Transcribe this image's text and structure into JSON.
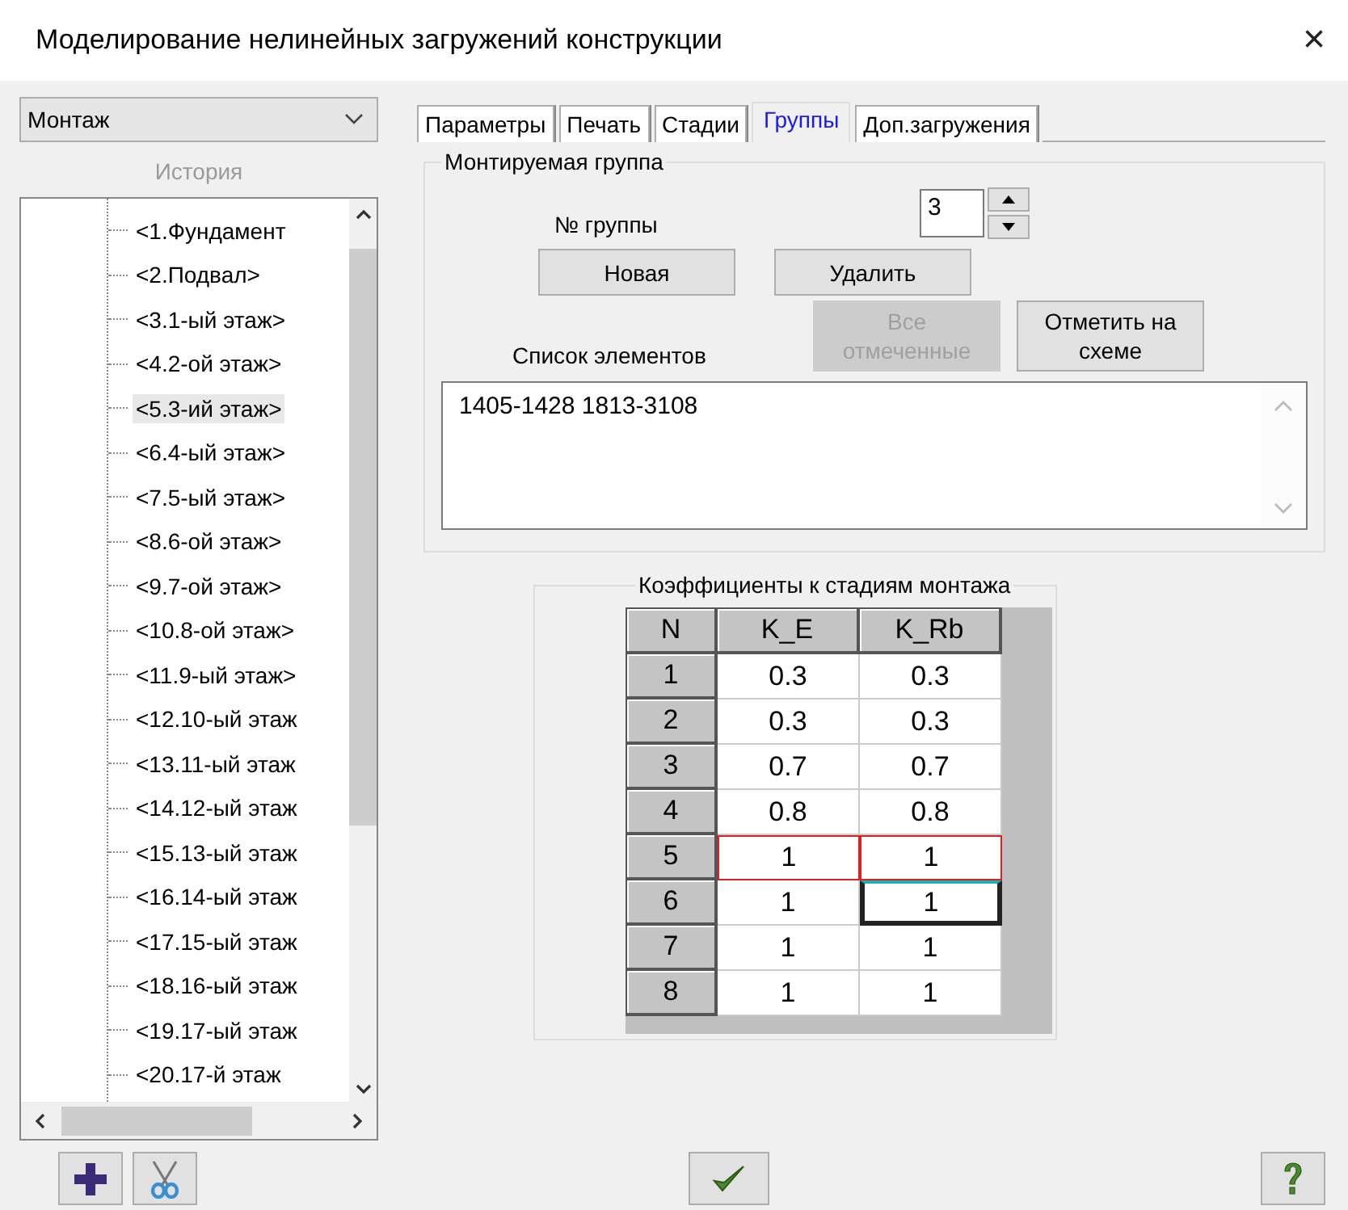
{
  "window": {
    "title": "Моделирование нелинейных загружений конструкции",
    "close": "×"
  },
  "sidebar": {
    "mode": "Монтаж",
    "history_label": "История",
    "history_disabled": true,
    "items": [
      {
        "label": "<1.Фундамент",
        "selected": false
      },
      {
        "label": "<2.Подвал>",
        "selected": false
      },
      {
        "label": "<3.1-ый этаж>",
        "selected": false
      },
      {
        "label": "<4.2-ой этаж>",
        "selected": false
      },
      {
        "label": "<5.3-ий этаж>",
        "selected": true
      },
      {
        "label": "<6.4-ый этаж>",
        "selected": false
      },
      {
        "label": "<7.5-ый этаж>",
        "selected": false
      },
      {
        "label": "<8.6-ой этаж>",
        "selected": false
      },
      {
        "label": "<9.7-ой этаж>",
        "selected": false
      },
      {
        "label": "<10.8-ой этаж>",
        "selected": false
      },
      {
        "label": "<11.9-ый этаж>",
        "selected": false
      },
      {
        "label": "<12.10-ый этаж",
        "selected": false
      },
      {
        "label": "<13.11-ый этаж",
        "selected": false
      },
      {
        "label": "<14.12-ый этаж",
        "selected": false
      },
      {
        "label": "<15.13-ый этаж",
        "selected": false
      },
      {
        "label": "<16.14-ый этаж",
        "selected": false
      },
      {
        "label": "<17.15-ый этаж",
        "selected": false
      },
      {
        "label": "<18.16-ый этаж",
        "selected": false
      },
      {
        "label": "<19.17-ый этаж",
        "selected": false
      },
      {
        "label": "<20.17-й этаж",
        "selected": false
      }
    ]
  },
  "tabs": [
    {
      "label": "Параметры",
      "selected": false
    },
    {
      "label": "Печать",
      "selected": false
    },
    {
      "label": "Стадии",
      "selected": false
    },
    {
      "label": "Группы",
      "selected": true
    },
    {
      "label": "Доп.загружения",
      "selected": false
    }
  ],
  "group": {
    "title": "Монтируемая группа",
    "number_label": "№ группы",
    "number": "3",
    "buttons": [
      {
        "label": "Новая",
        "disabled": false
      },
      {
        "label": "Удалить",
        "disabled": false
      }
    ],
    "list_label": "Список элементов",
    "side_buttons": [
      {
        "label": "Все отмеченные",
        "disabled": true
      },
      {
        "label": "Отметить на схеме",
        "disabled": false
      }
    ],
    "elements": "1405-1428 1813-3108"
  },
  "coefficients": {
    "title": "Коэффициенты к стадиям монтажа",
    "columns": [
      "N",
      "K_E",
      "K_Rb"
    ],
    "rows": [
      {
        "highlighted": false,
        "cells": [
          {
            "text": "1",
            "focused": false
          },
          {
            "text": "0.3",
            "focused": false
          },
          {
            "text": "0.3",
            "focused": false
          }
        ]
      },
      {
        "highlighted": false,
        "cells": [
          {
            "text": "2",
            "focused": false
          },
          {
            "text": "0.3",
            "focused": false
          },
          {
            "text": "0.3",
            "focused": false
          }
        ]
      },
      {
        "highlighted": false,
        "cells": [
          {
            "text": "3",
            "focused": false
          },
          {
            "text": "0.7",
            "focused": false
          },
          {
            "text": "0.7",
            "focused": false
          }
        ]
      },
      {
        "highlighted": false,
        "cells": [
          {
            "text": "4",
            "focused": false
          },
          {
            "text": "0.8",
            "focused": false
          },
          {
            "text": "0.8",
            "focused": false
          }
        ]
      },
      {
        "highlighted": true,
        "cells": [
          {
            "text": "5",
            "focused": false
          },
          {
            "text": "1",
            "focused": false
          },
          {
            "text": "1",
            "focused": false
          }
        ]
      },
      {
        "highlighted": false,
        "cells": [
          {
            "text": "6",
            "focused": false
          },
          {
            "text": "1",
            "focused": false
          },
          {
            "text": "1",
            "focused": true
          }
        ]
      },
      {
        "highlighted": false,
        "cells": [
          {
            "text": "7",
            "focused": false
          },
          {
            "text": "1",
            "focused": false
          },
          {
            "text": "1",
            "focused": false
          }
        ]
      },
      {
        "highlighted": false,
        "cells": [
          {
            "text": "8",
            "focused": false
          },
          {
            "text": "1",
            "focused": false
          },
          {
            "text": "1",
            "focused": false
          }
        ]
      }
    ]
  }
}
